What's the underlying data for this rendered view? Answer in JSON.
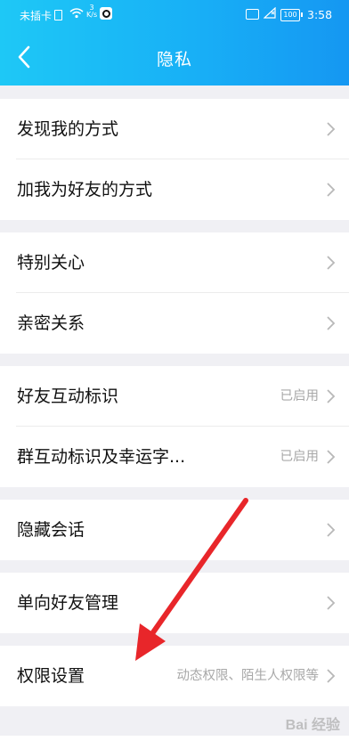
{
  "status_bar": {
    "carrier": "未插卡",
    "speed_top": "3",
    "speed_unit": "K/s",
    "battery": "100",
    "time": "3:58"
  },
  "header": {
    "title": "隐私",
    "back_icon": "chevron-left-icon"
  },
  "sections": [
    {
      "rows": [
        {
          "name": "row-find-me",
          "label": "发现我的方式",
          "value": ""
        },
        {
          "name": "row-add-me",
          "label": "加我为好友的方式",
          "value": ""
        }
      ]
    },
    {
      "rows": [
        {
          "name": "row-special-care",
          "label": "特别关心",
          "value": ""
        },
        {
          "name": "row-intimate",
          "label": "亲密关系",
          "value": ""
        }
      ]
    },
    {
      "rows": [
        {
          "name": "row-friend-interaction",
          "label": "好友互动标识",
          "value": "已启用"
        },
        {
          "name": "row-group-interaction",
          "label": "群互动标识及幸运字...",
          "value": "已启用"
        }
      ]
    },
    {
      "rows": [
        {
          "name": "row-hidden-chats",
          "label": "隐藏会话",
          "value": ""
        }
      ]
    },
    {
      "rows": [
        {
          "name": "row-one-way-friends",
          "label": "单向好友管理",
          "value": ""
        }
      ]
    },
    {
      "rows": [
        {
          "name": "row-permissions",
          "label": "权限设置",
          "value": "动态权限、陌生人权限等"
        }
      ]
    }
  ],
  "watermark": "Bai 经验",
  "colors": {
    "header_start": "#1ec8f6",
    "header_end": "#1597f2",
    "annotation_arrow": "#e8262a"
  }
}
